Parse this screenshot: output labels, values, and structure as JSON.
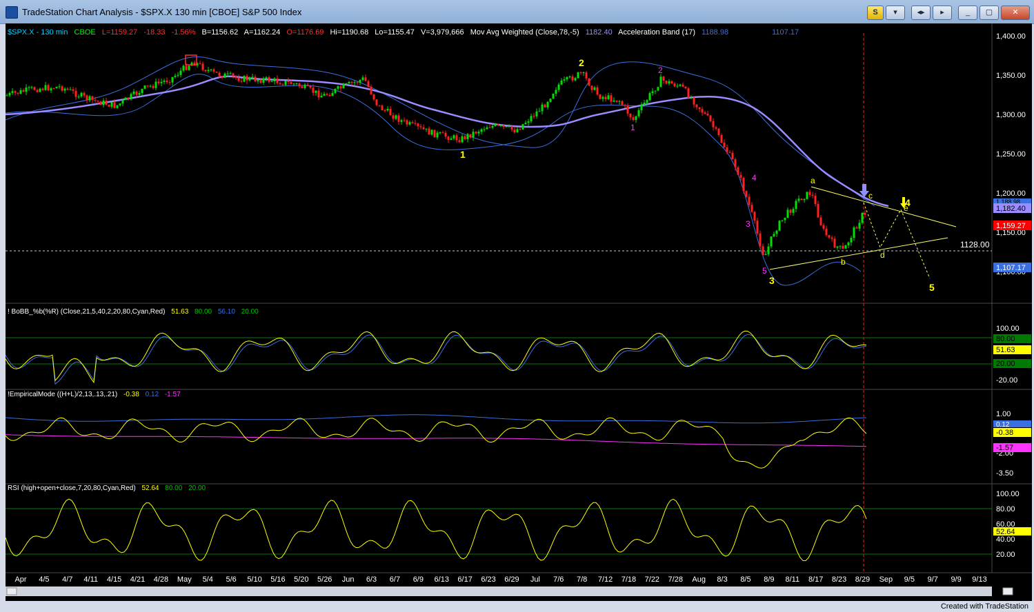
{
  "window": {
    "title": "TradeStation Chart Analysis - $SPX.X 130 min [CBOE] S&P 500 Index",
    "s_button": "S",
    "minimize": "_",
    "restore": "▢",
    "close": "✕",
    "arrows_button": "◂▸"
  },
  "header": {
    "symbol": "$SPX.X - 130 min",
    "exchange": "CBOE",
    "last": "L=1159.27",
    "chg": "-18.33",
    "pct": "-1.56%",
    "bid": "B=1156.62",
    "ask": "A=1162.24",
    "open": "O=1176.69",
    "high": "Hi=1190.68",
    "low": "Lo=1155.47",
    "volume": "V=3,979,666",
    "ma_label": "Mov Avg Weighted (Close,78,-5)",
    "ma_value": "1182.40",
    "ab_label": "Acceleration Band (17)",
    "ab_upper": "1188.98",
    "ab_lower": "1107.17"
  },
  "price_axis": {
    "ticks": [
      "1,400.00",
      "1,350.00",
      "1,300.00",
      "1,250.00",
      "1,200.00",
      "1,150.00",
      "1,100.00"
    ],
    "tags": [
      "1,188.98",
      "1,182.40",
      "1,159.27",
      "1,107.17"
    ],
    "level_label": "1128.00"
  },
  "wave_labels": {
    "yellow": [
      "1",
      "2",
      "3",
      "4",
      "5",
      "a",
      "b",
      "c",
      "d",
      "e"
    ],
    "magenta": [
      "1",
      "2",
      "3",
      "4",
      "5"
    ]
  },
  "panel_bobb": {
    "label": "! BoBB_%b(%R) (Close,21,5,40,2,20,80,Cyan,Red)",
    "v1": "51.63",
    "v2": "80.00",
    "v3": "56.10",
    "v4": "20.00",
    "ticks": [
      "100.00",
      "-20.00"
    ],
    "tags": [
      "80.00",
      "51.63",
      "20.00"
    ]
  },
  "panel_emd": {
    "label": "!EmpiricalMode ((H+L)/2,13,.13,.21)",
    "v1": "-0.38",
    "v2": "0.12",
    "v3": "-1.57",
    "ticks": [
      "1.00",
      "-2.00",
      "-3.50"
    ],
    "tags": [
      "0.12",
      "-0.38",
      "-1.57"
    ]
  },
  "panel_rsi": {
    "label": "RSI (high+open+close,7,20,80,Cyan,Red)",
    "v1": "52.64",
    "v2": "80.00",
    "v3": "20.00",
    "ticks": [
      "100.00",
      "80.00",
      "60.00",
      "40.00",
      "20.00"
    ],
    "tags": [
      "52.64"
    ]
  },
  "time_axis": [
    "Apr",
    "4/5",
    "4/7",
    "4/11",
    "4/15",
    "4/21",
    "4/28",
    "May",
    "5/4",
    "5/6",
    "5/10",
    "5/16",
    "5/20",
    "5/26",
    "Jun",
    "6/3",
    "6/7",
    "6/9",
    "6/13",
    "6/17",
    "6/23",
    "6/29",
    "Jul",
    "7/6",
    "7/8",
    "7/12",
    "7/18",
    "7/22",
    "7/28",
    "Aug",
    "8/3",
    "8/5",
    "8/9",
    "8/11",
    "8/17",
    "8/23",
    "8/29",
    "Sep",
    "9/5",
    "9/7",
    "9/9",
    "9/13"
  ],
  "footer": "Created with TradeStation",
  "colors": {
    "bg": "#000000",
    "up_candle": "#00e000",
    "down_candle": "#ff2020",
    "band": "#3a6fe0",
    "ma": "#9b8cff",
    "yellow": "#ffff00",
    "magenta": "#ff33ff"
  }
}
